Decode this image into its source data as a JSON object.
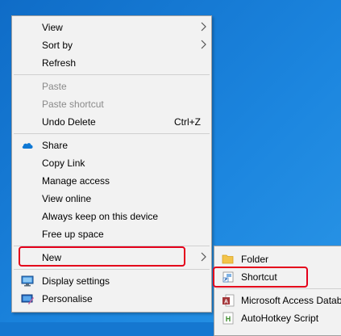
{
  "menu": {
    "items": [
      {
        "label": "View"
      },
      {
        "label": "Sort by"
      },
      {
        "label": "Refresh"
      },
      {
        "label": "Paste"
      },
      {
        "label": "Paste shortcut"
      },
      {
        "label": "Undo Delete",
        "shortcut": "Ctrl+Z"
      },
      {
        "label": "Share"
      },
      {
        "label": "Copy Link"
      },
      {
        "label": "Manage access"
      },
      {
        "label": "View online"
      },
      {
        "label": "Always keep on this device"
      },
      {
        "label": "Free up space"
      },
      {
        "label": "New"
      },
      {
        "label": "Display settings"
      },
      {
        "label": "Personalise"
      }
    ]
  },
  "submenu": {
    "items": [
      {
        "label": "Folder"
      },
      {
        "label": "Shortcut"
      },
      {
        "label": "Microsoft Access Datab"
      },
      {
        "label": "AutoHotkey Script"
      }
    ]
  },
  "colors": {
    "highlight_border": "#e4001b",
    "desktop": "#1577d0"
  }
}
